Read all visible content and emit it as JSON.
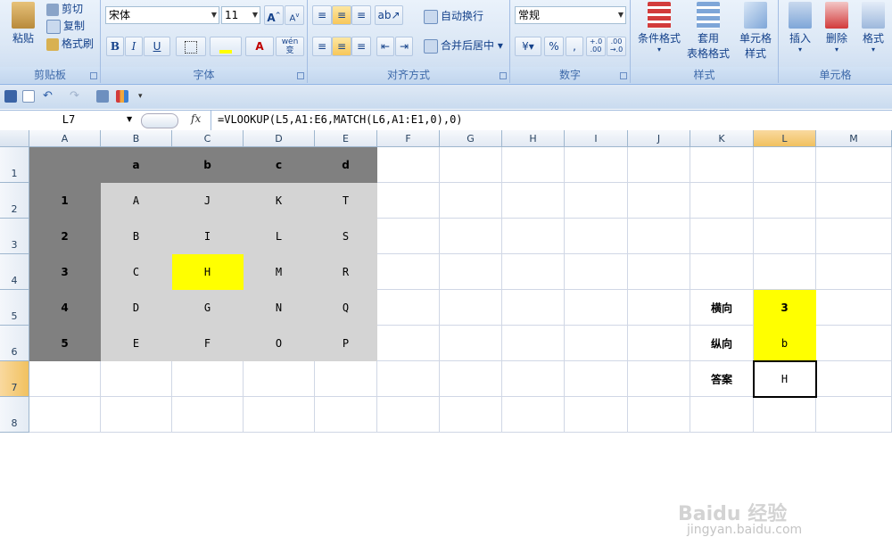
{
  "ribbon": {
    "clipboard": {
      "group_label": "剪贴板",
      "paste": "粘贴",
      "cut": "剪切",
      "copy": "复制",
      "format_painter": "格式刷"
    },
    "font": {
      "group_label": "字体",
      "font_name": "宋体",
      "font_size": "11",
      "bold": "B",
      "italic": "I",
      "underline": "U",
      "font_color_letter": "A",
      "phonetic": "wén 变"
    },
    "alignment": {
      "group_label": "对齐方式",
      "wrap_text": "自动换行",
      "merge_center": "合并后居中"
    },
    "number": {
      "group_label": "数字",
      "format": "常规",
      "percent": "%",
      "comma": ",",
      "inc_decimal": "+.0 .00",
      "dec_decimal": ".00 →.0"
    },
    "styles": {
      "group_label": "样式",
      "conditional": "条件格式",
      "table_format_1": "套用",
      "table_format_2": "表格格式",
      "cell_styles_1": "单元格",
      "cell_styles_2": "样式"
    },
    "cells": {
      "group_label": "单元格",
      "insert": "插入",
      "delete": "删除",
      "format": "格式"
    }
  },
  "formula_bar": {
    "name_box": "L7",
    "fx": "fx",
    "formula": "=VLOOKUP(L5,A1:E6,MATCH(L6,A1:E1,0),0)"
  },
  "columns": [
    "A",
    "B",
    "C",
    "D",
    "E",
    "F",
    "G",
    "H",
    "I",
    "J",
    "K",
    "L",
    "M"
  ],
  "selected_column": "L",
  "rows": [
    "1",
    "2",
    "3",
    "4",
    "5",
    "6",
    "7",
    "8"
  ],
  "selected_row": "7",
  "table": {
    "header": [
      "",
      "a",
      "b",
      "c",
      "d"
    ],
    "body": [
      [
        "1",
        "A",
        "J",
        "K",
        "T"
      ],
      [
        "2",
        "B",
        "I",
        "L",
        "S"
      ],
      [
        "3",
        "C",
        "H",
        "M",
        "R"
      ],
      [
        "4",
        "D",
        "G",
        "N",
        "Q"
      ],
      [
        "5",
        "E",
        "F",
        "O",
        "P"
      ]
    ]
  },
  "lookup": {
    "row_label": "横向",
    "row_value": "3",
    "col_label": "纵向",
    "col_value": "b",
    "answer_label": "答案",
    "answer_value": "H"
  },
  "watermark": {
    "text": "Baidu 经验",
    "url": "jingyan.baidu.com"
  },
  "colors": {
    "dark_header": "#808080",
    "light_body": "#d4d4d4",
    "highlight": "#ffff00"
  }
}
